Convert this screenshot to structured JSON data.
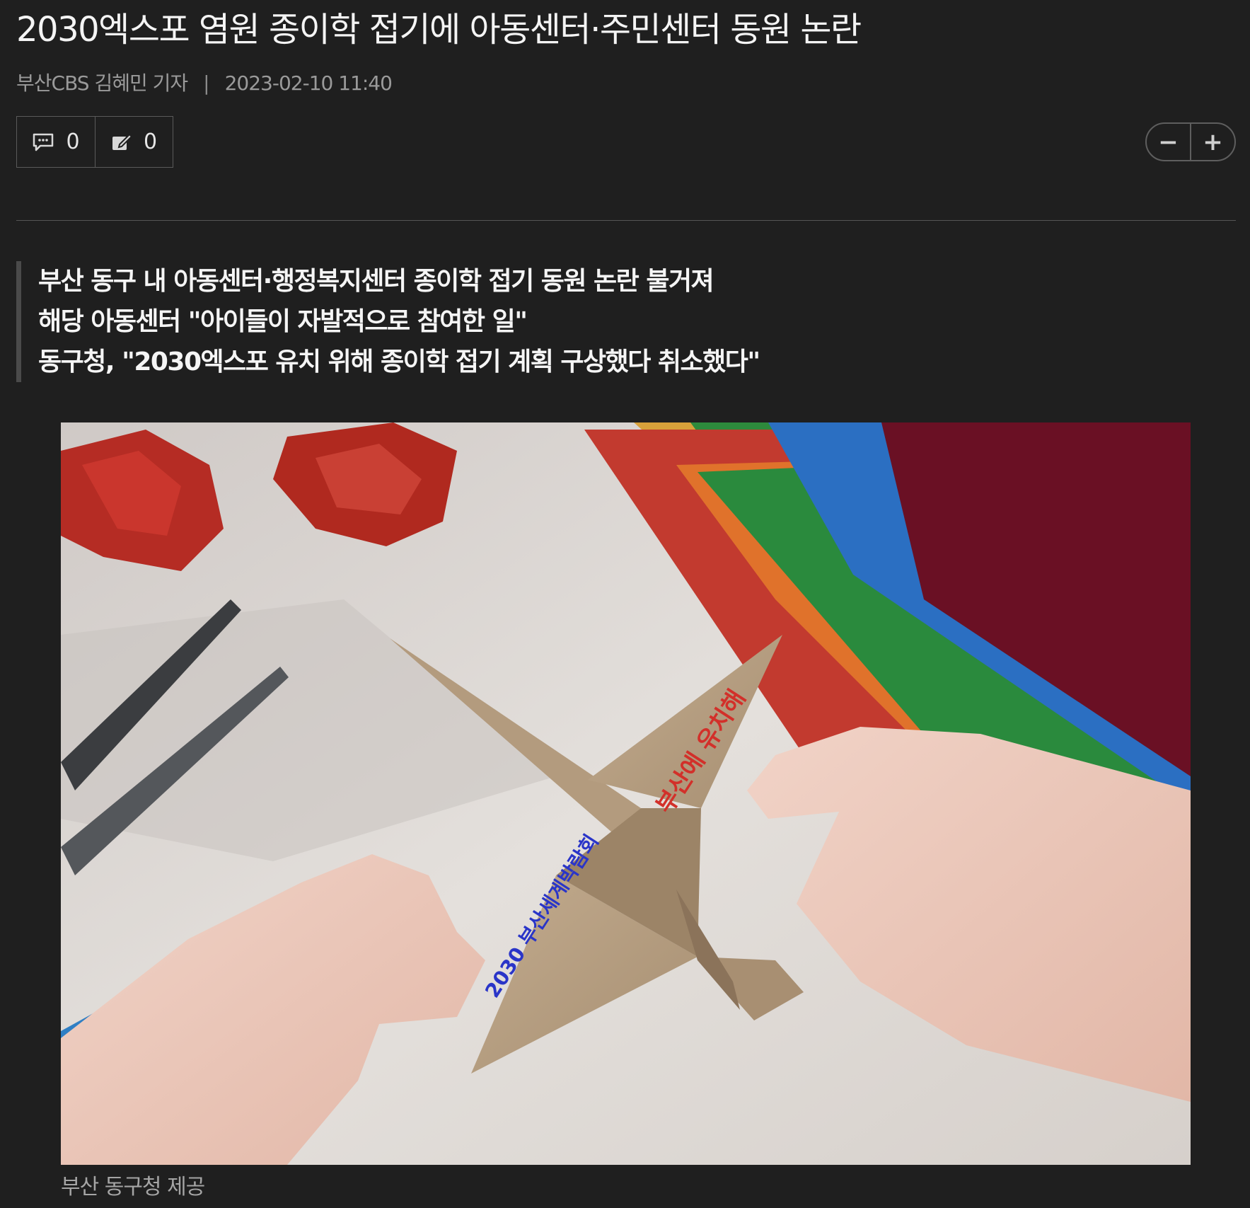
{
  "article": {
    "headline": "2030엑스포 염원 종이학 접기에 아동센터·주민센터 동원 논란",
    "author": "부산CBS 김혜민 기자",
    "separator": "|",
    "datetime": "2023-02-10 11:40"
  },
  "counters": {
    "comments": {
      "icon": "comment-icon",
      "value": "0"
    },
    "share": {
      "icon": "write-icon",
      "value": "0"
    }
  },
  "font_size_control": {
    "decrease": "−",
    "increase": "+"
  },
  "summary": {
    "lines": [
      "부산 동구 내 아동센터·행정복지센터 종이학 접기 동원 논란 불거져",
      "해당 아동센터 \"아이들이 자발적으로 참여한 일\"",
      "동구청, \"2030엑스포 유치 위해 종이학 접기 계획 구상했다 취소했다\""
    ]
  },
  "photo": {
    "text_red": "부산에 유치해",
    "text_blue": "2030 부산세계박람회",
    "caption": "부산 동구청 제공"
  },
  "colors": {
    "background": "#1f1f1f",
    "text": "#f2f2f2",
    "muted": "#9a9a9a",
    "border": "#5a5a5a"
  }
}
